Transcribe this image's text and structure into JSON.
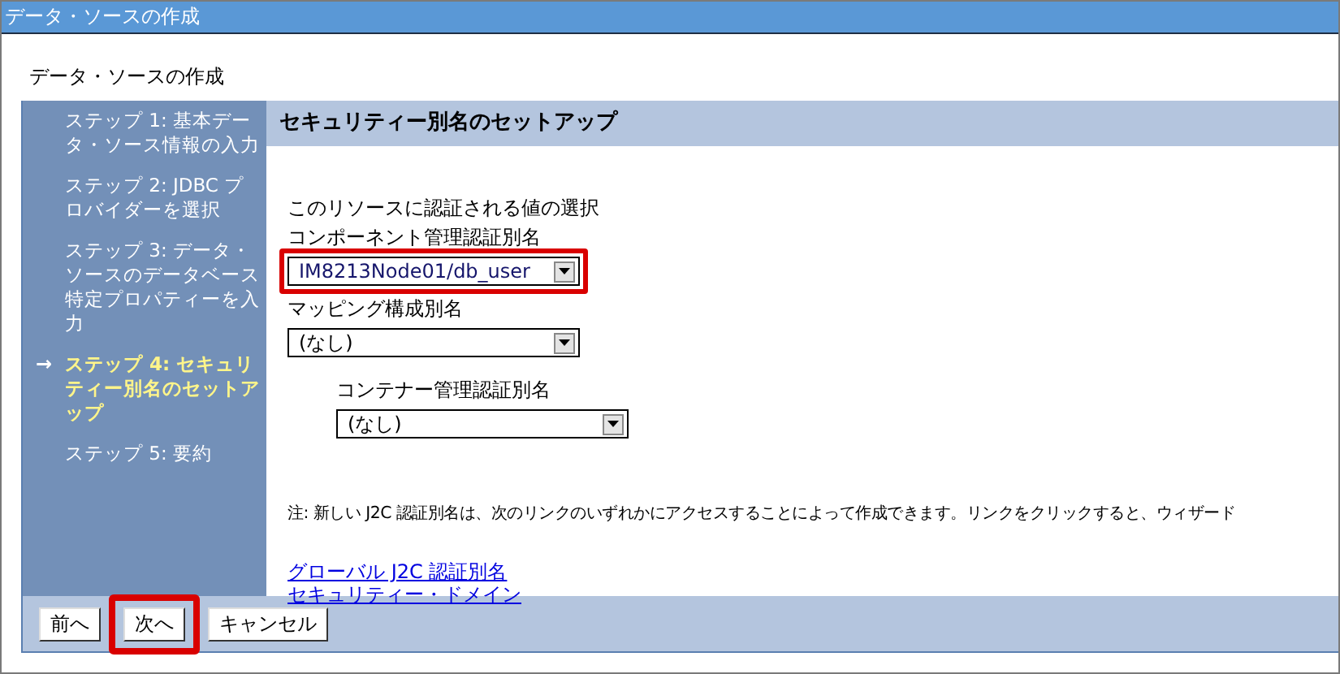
{
  "window": {
    "title": "データ・ソースの作成"
  },
  "page_heading": "データ・ソースの作成",
  "current_marker": "→",
  "steps": [
    {
      "label": "ステップ 1: 基本データ・ソース情報の入力",
      "selected": false
    },
    {
      "label": "ステップ 2: JDBC プロバイダーを選択",
      "selected": false
    },
    {
      "label": "ステップ 3: データ・ソースのデータベース特定プロパティーを入力",
      "selected": false
    },
    {
      "label": "ステップ 4: セキュリティー別名のセットアップ",
      "selected": true
    },
    {
      "label": "ステップ 5: 要約",
      "selected": false
    }
  ],
  "section_title": "セキュリティー別名のセットアップ",
  "intro": "このリソースに認証される値の選択",
  "fields": [
    {
      "label": "コンポーネント管理認証別名",
      "value": "IM8213Node01/db_user",
      "highlighted": true
    },
    {
      "label": "マッピング構成別名",
      "value": "(なし)",
      "highlighted": false,
      "children": [
        {
          "label": "コンテナー管理認証別名",
          "value": "(なし)",
          "highlighted": false
        }
      ]
    }
  ],
  "note": "注: 新しい J2C 認証別名は、次のリンクのいずれかにアクセスすることによって作成できます。リンクをクリックすると、ウィザード",
  "links": [
    "グローバル J2C 認証別名",
    "セキュリティー・ドメイン"
  ],
  "buttons": [
    {
      "label": "前へ",
      "highlighted": false
    },
    {
      "label": "次へ",
      "highlighted": true
    },
    {
      "label": "キャンセル",
      "highlighted": false
    }
  ]
}
